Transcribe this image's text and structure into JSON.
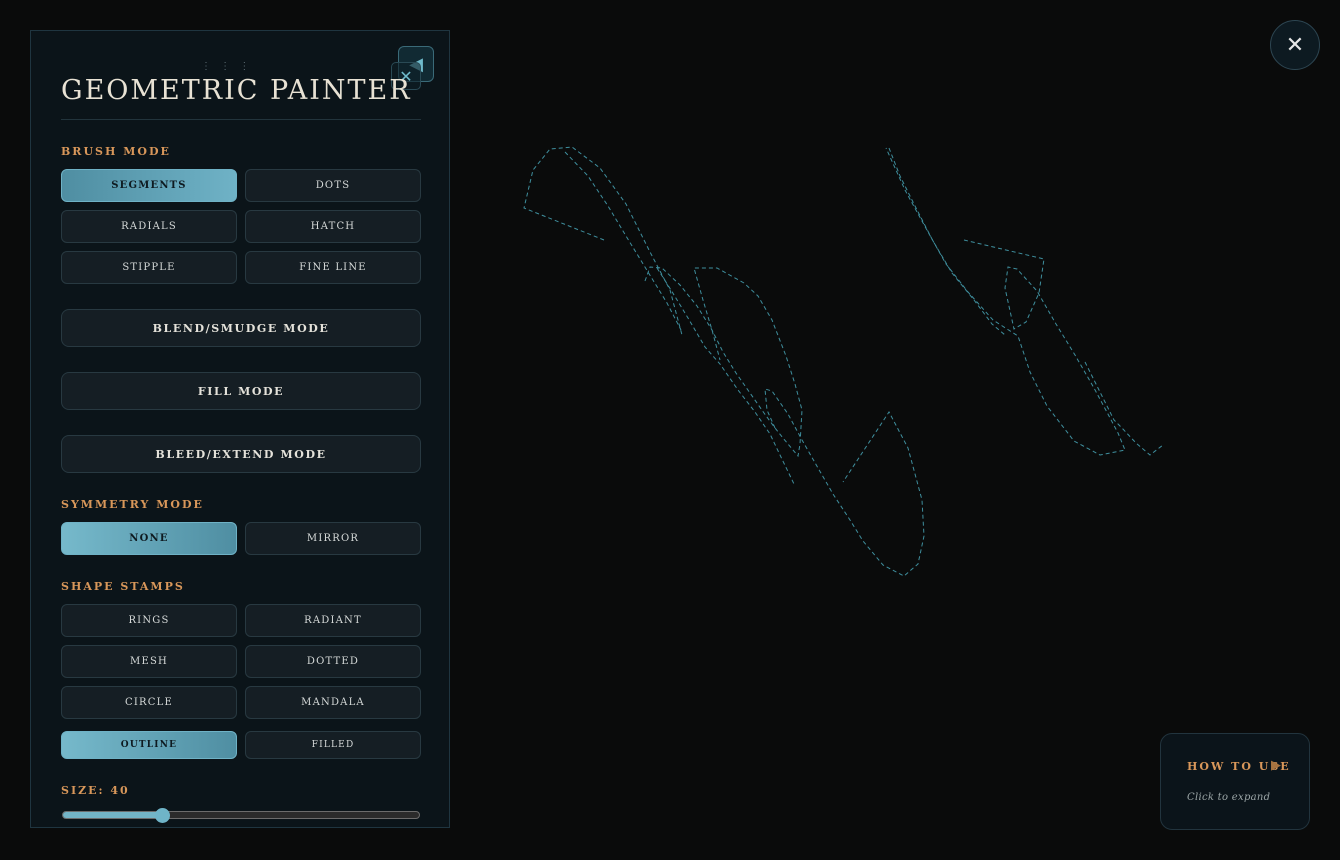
{
  "colors": {
    "background": "#0a0b0b",
    "panel": "#0b1419",
    "accent": "#6fb2c6",
    "label_orange": "#d8975a",
    "stroke": "#3f8f9e"
  },
  "panel": {
    "title": "GEOMETRIC PAINTER",
    "drag_handle_icon": "drag-dots-icon",
    "collapse_icon": "◀",
    "close_icon": "✕"
  },
  "brush_mode": {
    "label": "BRUSH MODE",
    "options": [
      "SEGMENTS",
      "DOTS",
      "RADIALS",
      "HATCH",
      "STIPPLE",
      "FINE LINE"
    ],
    "selected": "SEGMENTS"
  },
  "modes": {
    "blend": "BLEND/SMUDGE MODE",
    "fill": "FILL MODE",
    "bleed": "BLEED/EXTEND MODE"
  },
  "symmetry_mode": {
    "label": "SYMMETRY MODE",
    "options": [
      "NONE",
      "MIRROR"
    ],
    "selected": "NONE"
  },
  "shape_stamps": {
    "label": "SHAPE STAMPS",
    "options": [
      "RINGS",
      "RADIANT",
      "MESH",
      "DOTTED",
      "CIRCLE",
      "MANDALA"
    ],
    "style_options": [
      "OUTLINE",
      "FILLED"
    ],
    "style_selected": "OUTLINE"
  },
  "size": {
    "label": "SIZE: 40",
    "value": 40,
    "fraction": 0.28
  },
  "close_button": {
    "icon": "✕"
  },
  "help": {
    "title": "HOW TO USE",
    "arrow": "▶",
    "subtitle": "Click to expand"
  }
}
